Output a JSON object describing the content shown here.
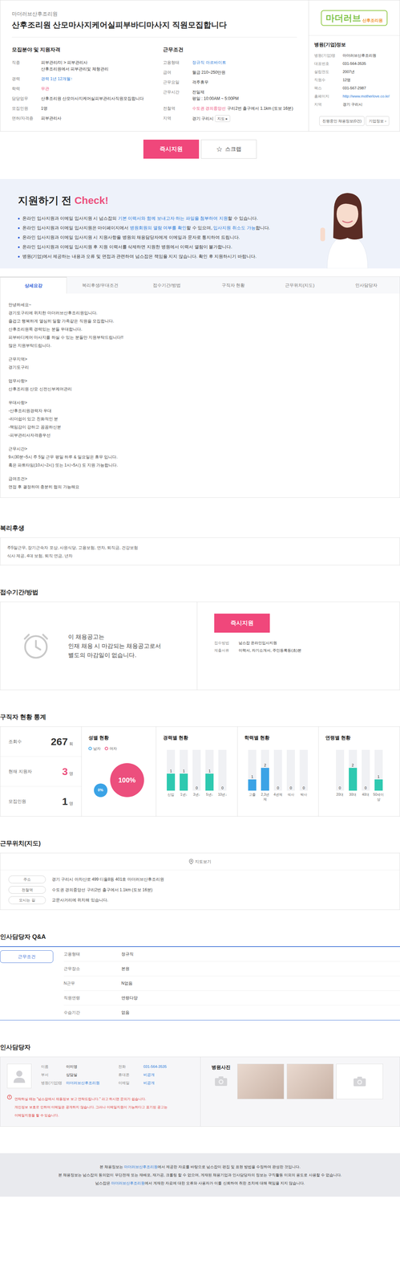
{
  "header": {
    "company": "마더러브산후조리원",
    "title": "산후조리원 산모마사지케어실피부바디마사지 직원모집합니다",
    "recruit": {
      "heading": "모집분야 및 지원자격",
      "rows": [
        {
          "label": "직종",
          "lines": [
            [
              {
                "text": "피부관리/미 > 피부관리사",
                "kind": "plain"
              }
            ],
            [
              {
                "text": "산후조리원에서 피부관리및 체형관리",
                "kind": "plain"
              }
            ]
          ]
        },
        {
          "label": "경력",
          "lines": [
            [
              {
                "text": "경력 1년 12개월↑",
                "kind": "link"
              }
            ]
          ]
        },
        {
          "label": "학력",
          "lines": [
            [
              {
                "text": "무관",
                "kind": "accent"
              }
            ]
          ]
        },
        {
          "label": "담당업무",
          "lines": [
            [
              {
                "text": "산후조리원 산모마사지케어실피부관리사직원모집합니다",
                "kind": "plain"
              }
            ]
          ]
        },
        {
          "label": "모집인원",
          "lines": [
            [
              {
                "text": "1명",
                "kind": "plain"
              }
            ]
          ]
        },
        {
          "label": "면허/자격증",
          "lines": [
            [
              {
                "text": "피부관리사",
                "kind": "plain"
              }
            ]
          ]
        }
      ]
    },
    "conditions": {
      "heading": "근무조건",
      "rows": [
        {
          "label": "고용형태",
          "lines": [
            [
              {
                "text": "정규직",
                "kind": "link"
              },
              {
                "text": "아르바이트",
                "kind": "link"
              }
            ]
          ]
        },
        {
          "label": "급여",
          "lines": [
            [
              {
                "text": "월급 210~250만원",
                "kind": "plain"
              }
            ]
          ]
        },
        {
          "label": "근무요일",
          "lines": [
            [
              {
                "text": "격주휴무",
                "kind": "plain"
              }
            ]
          ]
        },
        {
          "label": "근무시간",
          "lines": [
            [
              {
                "text": "전일제",
                "kind": "plain"
              }
            ],
            [
              {
                "text": "평일 : 10:00AM ~ 5:00PM",
                "kind": "plain"
              }
            ]
          ]
        },
        {
          "label": "전철역",
          "lines": [
            [
              {
                "text": "수도권 경의중앙선",
                "kind": "accent"
              },
              {
                "text": "구리2번 출구에서 1.1km (도보 16분)",
                "kind": "plain"
              }
            ]
          ]
        },
        {
          "label": "지역",
          "lines": [
            [
              {
                "text": "경기 구리시",
                "kind": "plain"
              },
              {
                "text": "지도 ▸",
                "kind": "button"
              }
            ]
          ]
        }
      ]
    }
  },
  "sidebar": {
    "logo": {
      "main": "마더러브",
      "sub": "산후조리원"
    },
    "heading": "병원(기업)정보",
    "rows": [
      {
        "label": "병원(기업)명",
        "value": "마더러브산후조리원",
        "kind": "plain"
      },
      {
        "label": "대표번호",
        "value": "031-564-3535",
        "kind": "plain"
      },
      {
        "label": "설립연도",
        "value": "2007년",
        "kind": "plain"
      },
      {
        "label": "직원수",
        "value": "12명",
        "kind": "plain"
      },
      {
        "label": "팩스",
        "value": "031-567-2987",
        "kind": "plain"
      },
      {
        "label": "홈페이지",
        "value": "http://www.motherlove.co.kr/",
        "kind": "link"
      },
      {
        "label": "지역",
        "value": "경기 구리시",
        "kind": "plain"
      }
    ],
    "buttons": [
      "진행중인 채용정보(0건)",
      "기업정보 ›"
    ]
  },
  "actions": {
    "apply": "즉시지원",
    "scrap_icon": "☆",
    "scrap": "스크랩"
  },
  "check": {
    "title": "지원하기 전 ",
    "accent": "Check!",
    "items": [
      [
        {
          "text": "온라인 입사지원과 이메일 입사지원 시 넘스잡의 ",
          "kind": "plain"
        },
        {
          "text": "기본 이력서와 함께 보내고자 하는 파일을 첨부하여 지원",
          "kind": "link"
        },
        {
          "text": "할 수 있습니다.",
          "kind": "plain"
        }
      ],
      [
        {
          "text": "온라인 입사지원과 이메일 입사지원은 마이페이지에서 ",
          "kind": "plain"
        },
        {
          "text": "병원회원의 열람 여부를 확인",
          "kind": "link"
        },
        {
          "text": "할 수 있으며, ",
          "kind": "plain"
        },
        {
          "text": "입사지원 취소도 가능",
          "kind": "link"
        },
        {
          "text": "합니다.",
          "kind": "plain"
        }
      ],
      [
        {
          "text": "온라인 입사지원과 이메일 입사지원 시 지원사항을 병원의 채용담당자에게 이메일과 문자로 통지하여 드립니다.",
          "kind": "plain"
        }
      ],
      [
        {
          "text": "온라인 입사지원과 이메일 입사지원 후 지원 이력서를 삭제하면 지원한 병원에서 이력서 열람이 불가합니다.",
          "kind": "plain"
        }
      ],
      [
        {
          "text": "병원(기업)에서 제공하는 내용과 오류 및 면접과 관련하여 넘스잡은 책임을 지지 않습니다. 확인 후 지원하시기 바랍니다.",
          "kind": "plain"
        }
      ]
    ]
  },
  "tabs": [
    {
      "label": "상세요강",
      "selected": true
    },
    {
      "label": "복리후생/우대조건",
      "selected": false
    },
    {
      "label": "접수기간/방법",
      "selected": false
    },
    {
      "label": "구직자 현황",
      "selected": false
    },
    {
      "label": "근무위치(지도)",
      "selected": false
    },
    {
      "label": "인사담당자",
      "selected": false
    }
  ],
  "detail": {
    "paragraphs": [
      [
        "안녕하세요~",
        "경기도구리에 위치한 마더러브산후조리원입니다.",
        "즐겁고 행복하게 열심히 일할 가족같은 직원을 모집합니다.",
        "산후조리원쪽 경력있는 분들 우대합니다.",
        "피부바디케어 마사지를 하실 수 있는 분들만 지원부탁드립니다!!",
        "많은 지원부탁드립니다."
      ],
      [
        "근무지역>",
        "경기도구리"
      ],
      [
        "업무사항>",
        "산후조리원 산모 신전신부케어관리"
      ],
      [
        "우대사항>",
        "-산후조리원경력자 우대",
        "-리더쉽이 있고 친화적인 분",
        "-책임감이 강하고 꼼꼼하신분",
        "-피부관리사자격증우선"
      ],
      [
        "근무시간>",
        "9시30분~5시 주 5일 근무 평일 하루 & 일요일은 휴무 입니다.",
        "혹은 파트타임(10시~2시) 또는 1시~5시) 도 지원 가능합니다."
      ],
      [
        "급여조건>",
        "면접 후 결정하며 충분히 협의 가능해요"
      ]
    ]
  },
  "welfare": {
    "heading": "복리후생",
    "lines": [
      "주5일근무, 장기근속자 포상, 사원식당, 고용보험, 연차, 퇴직금, 건강보험",
      "식사 제공, 4대 보험, 퇴직 연금, 년차"
    ]
  },
  "apply": {
    "heading": "접수기간/방법",
    "notice": [
      "이 채용공고는",
      "인재 채용 시 마감되는 채용공고로서",
      "별도의 마감일이 없습니다."
    ],
    "button": "즉시지원",
    "rows": [
      {
        "label": "접수방법",
        "value": "넘스잡 온라인입사지원"
      },
      {
        "label": "제출서류",
        "value": "이력서, 자기소개서, 주민등록등(초)본"
      }
    ]
  },
  "stats": {
    "heading": "구직자 현황 통계",
    "summary": [
      {
        "label": "조회수",
        "value": "267",
        "unit": "회",
        "kind": "plain"
      },
      {
        "label": "현재 지원자",
        "value": "3",
        "unit": "명",
        "kind": "accent"
      },
      {
        "label": "모집인원",
        "value": "1",
        "unit": "명",
        "kind": "plain"
      }
    ],
    "gender": {
      "title": "성별 현황",
      "legend": [
        {
          "label": "남자",
          "color": "#3ba3e6"
        },
        {
          "label": "여자",
          "color": "#ec4f7d"
        }
      ],
      "values": [
        0,
        100
      ],
      "labels": [
        "0%",
        "100%"
      ]
    },
    "charts": [
      {
        "title": "경력별 현황",
        "color": "#2ec9b0",
        "labels": [
          "신입",
          "1년↓",
          "3년↓",
          "5년↓",
          "10년↓"
        ],
        "values": [
          1,
          1,
          0,
          1,
          0
        ],
        "value_texts": [
          "1",
          "1",
          "0",
          "1",
          "0"
        ]
      },
      {
        "title": "학력별 현황",
        "color": "#3ba3e6",
        "labels": [
          "고졸",
          "2,3년제",
          "4년제",
          "석사",
          "박사"
        ],
        "values": [
          1,
          2,
          0,
          0,
          0
        ],
        "value_texts": [
          "1",
          "2",
          "0",
          "0",
          "0"
        ]
      },
      {
        "title": "연령별 현황",
        "color": "#2ec9b0",
        "labels": [
          "20대",
          "30대",
          "40대",
          "50세이상"
        ],
        "values": [
          0,
          2,
          0,
          1
        ],
        "value_texts": [
          "0",
          "2",
          "0",
          "1"
        ]
      }
    ]
  },
  "location": {
    "heading": "근무위치(지도)",
    "map_button": "지도보기",
    "rows": [
      {
        "label": "주소",
        "value": "경기 구리시 아차산로 499 디올8동 401호 마더러브산후조리원"
      },
      {
        "label": "전철역",
        "value": "수도권 경의중앙선 구리2번 출구에서 1.1km (도보 16분)"
      },
      {
        "label": "오시는 길",
        "value": "교문사거리에 위치해 있습니다."
      }
    ]
  },
  "qa": {
    "heading": "인사담당자 Q&A",
    "tabs": [
      {
        "label": "근무조건",
        "selected": true
      }
    ],
    "rows": [
      {
        "label": "고용형태",
        "value": "정규직"
      },
      {
        "label": "근무장소",
        "value": "본원"
      },
      {
        "label": "N근무",
        "value": "N없음"
      },
      {
        "label": "직원연령",
        "value": "연령다양"
      },
      {
        "label": "수습기간",
        "value": "없음"
      }
    ]
  },
  "contact": {
    "heading": "인사담당자",
    "left": [
      {
        "label": "이름",
        "value": "이미영",
        "kind": "plain"
      },
      {
        "label": "부서",
        "value": "상담실",
        "kind": "plain"
      },
      {
        "label": "병원(기업)명",
        "value": "마더러브산후조리원",
        "kind": "link"
      }
    ],
    "right": [
      {
        "label": "전화",
        "value": "031-564-3535",
        "kind": "link"
      },
      {
        "label": "휴대폰",
        "value": "비공개",
        "kind": "link"
      },
      {
        "label": "이메일",
        "value": "비공개",
        "kind": "link"
      }
    ],
    "notice": [
      "연락하실 때는 \"넘스잡에서 채용정보 보고 연락드립니다.\" 라고 하시면 문의가 쉽습니다.",
      "개인정보 보호로 인하여 이메일은 공개하지 않습니다. 그러나 이메일지원이 가능하다고 표기된 공고는",
      "이메일지원을 할 수 있습니다."
    ],
    "photos_title": "병원사진",
    "photos": [
      {
        "kind": "photo"
      },
      {
        "kind": "photo"
      },
      {
        "kind": "empty"
      }
    ]
  },
  "footer": {
    "lines": [
      [
        {
          "text": "본 채용정보는 ",
          "kind": "plain"
        },
        {
          "text": "마더러브산후조리원",
          "kind": "link"
        },
        {
          "text": "에서 제공한 자료를 바탕으로 넘스잡이 편집 및 표현 방법을 수정하여 완성한 것입니다.",
          "kind": "plain"
        }
      ],
      [
        {
          "text": "본 채용정보는 넘스잡의 동의없이 무단전재 또는 재배포, 재가공, 크롤링 할 수 없으며, 게재된 채용기업과 인사담당자의 정보는 구직활동 이외의 용도로 사용할 수 없습니다.",
          "kind": "plain"
        }
      ],
      [
        {
          "text": "넘스잡은 ",
          "kind": "plain"
        },
        {
          "text": "마더러브산후조리원",
          "kind": "link"
        },
        {
          "text": "에서 게재한 자료에 대한 오류와 사용자가 이를 신뢰하여 취한 조치에 대해 책임을 지지 않습니다.",
          "kind": "plain"
        }
      ]
    ]
  }
}
